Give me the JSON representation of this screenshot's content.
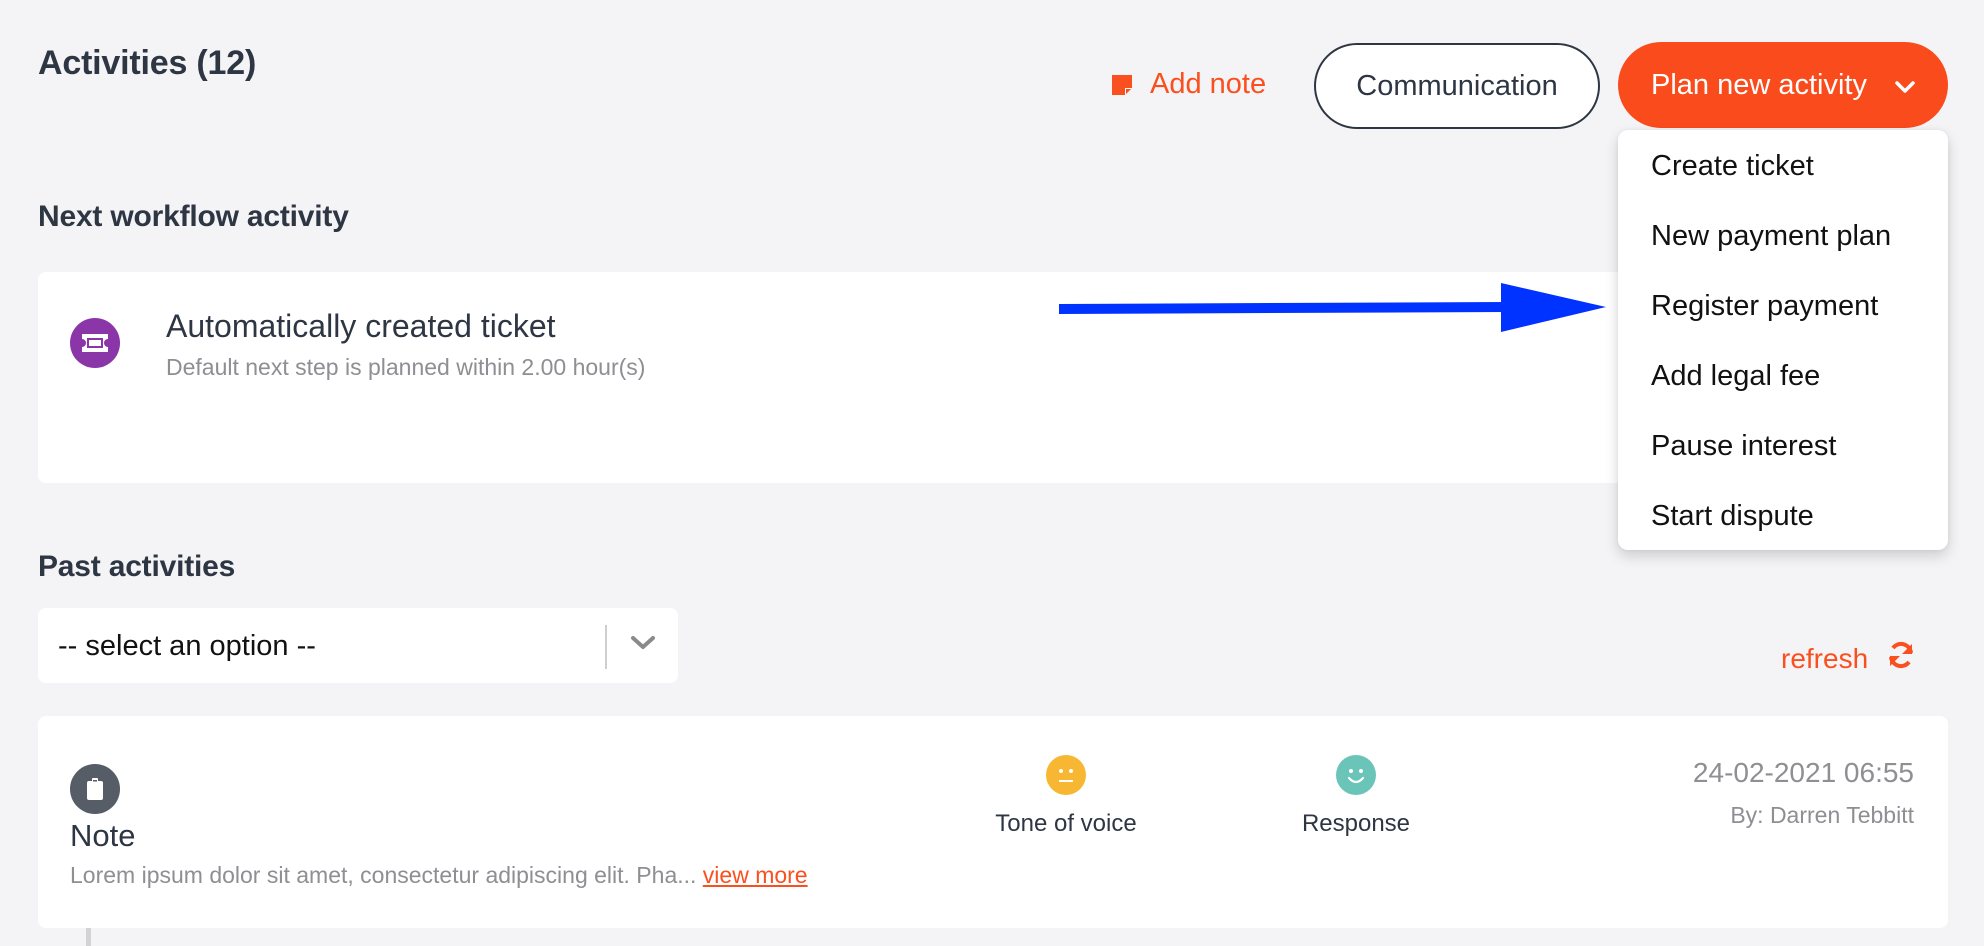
{
  "header": {
    "title": "Activities (12)",
    "add_note_label": "Add note",
    "communication_label": "Communication",
    "plan_label": "Plan new activity"
  },
  "plan_menu": {
    "items": [
      {
        "label": "Create ticket"
      },
      {
        "label": "New payment plan"
      },
      {
        "label": "Register payment"
      },
      {
        "label": "Add legal fee"
      },
      {
        "label": "Pause interest"
      },
      {
        "label": "Start dispute"
      }
    ]
  },
  "next_workflow": {
    "heading": "Next workflow activity",
    "title": "Automatically created ticket",
    "subtitle": "Default next step is planned within 2.00 hour(s)",
    "icon": "ticket-icon"
  },
  "annotation": {
    "type": "arrow",
    "color": "#0033ff",
    "points_to": "Register payment"
  },
  "past": {
    "heading": "Past activities",
    "filter_value": "-- select an option --",
    "refresh_label": "refresh",
    "items": [
      {
        "type": "Note",
        "icon": "clipboard-icon",
        "body": "Lorem ipsum dolor sit amet, consectetur adipiscing elit. Pha...",
        "view_more": "view more",
        "tone_label": "Tone of voice",
        "tone": "neutral",
        "response_label": "Response",
        "response": "happy",
        "date": "24-02-2021 06:55",
        "author": "By: Darren Tebbitt"
      }
    ]
  },
  "colors": {
    "accent": "#fa4b1c",
    "text": "#2e3644",
    "muted": "#8e8e93",
    "ticket": "#8a35a8",
    "note": "#565d66",
    "neutral_face": "#f7b733",
    "happy_face": "#6ac5b8",
    "background": "#f4f4f6"
  }
}
